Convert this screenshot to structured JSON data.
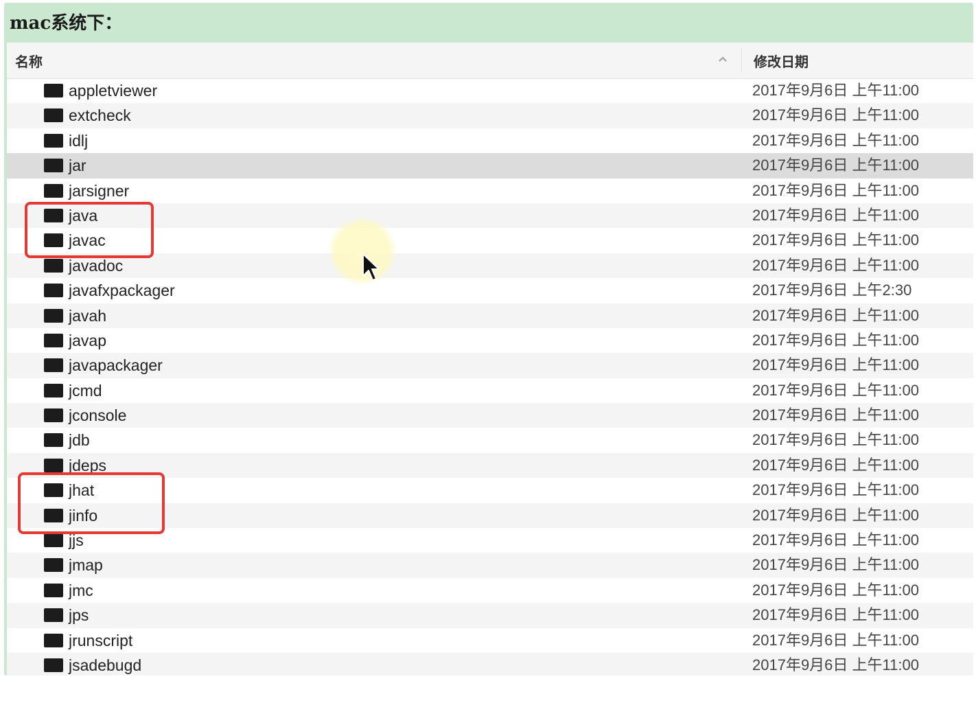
{
  "caption": "mac系统下：",
  "header": {
    "name_label": "名称",
    "date_label": "修改日期",
    "sort_icon": "chevron-up-icon"
  },
  "files": [
    {
      "name": "appletviewer",
      "date": "2017年9月6日 上午11:00"
    },
    {
      "name": "extcheck",
      "date": "2017年9月6日 上午11:00"
    },
    {
      "name": "idlj",
      "date": "2017年9月6日 上午11:00"
    },
    {
      "name": "jar",
      "date": "2017年9月6日 上午11:00"
    },
    {
      "name": "jarsigner",
      "date": "2017年9月6日 上午11:00"
    },
    {
      "name": "java",
      "date": "2017年9月6日 上午11:00"
    },
    {
      "name": "javac",
      "date": "2017年9月6日 上午11:00"
    },
    {
      "name": "javadoc",
      "date": "2017年9月6日 上午11:00"
    },
    {
      "name": "javafxpackager",
      "date": "2017年9月6日 上午2:30"
    },
    {
      "name": "javah",
      "date": "2017年9月6日 上午11:00"
    },
    {
      "name": "javap",
      "date": "2017年9月6日 上午11:00"
    },
    {
      "name": "javapackager",
      "date": "2017年9月6日 上午11:00"
    },
    {
      "name": "jcmd",
      "date": "2017年9月6日 上午11:00"
    },
    {
      "name": "jconsole",
      "date": "2017年9月6日 上午11:00"
    },
    {
      "name": "jdb",
      "date": "2017年9月6日 上午11:00"
    },
    {
      "name": "jdeps",
      "date": "2017年9月6日 上午11:00"
    },
    {
      "name": "jhat",
      "date": "2017年9月6日 上午11:00"
    },
    {
      "name": "jinfo",
      "date": "2017年9月6日 上午11:00"
    },
    {
      "name": "jjs",
      "date": "2017年9月6日 上午11:00"
    },
    {
      "name": "jmap",
      "date": "2017年9月6日 上午11:00"
    },
    {
      "name": "jmc",
      "date": "2017年9月6日 上午11:00"
    },
    {
      "name": "jps",
      "date": "2017年9月6日 上午11:00"
    },
    {
      "name": "jrunscript",
      "date": "2017年9月6日 上午11:00"
    },
    {
      "name": "jsadebugd",
      "date": "2017年9月6日 上午11:00"
    }
  ],
  "selected_file": "jar",
  "highlighted_files": [
    "java",
    "javac",
    "jhat",
    "jinfo"
  ],
  "colors": {
    "caption_bg": "#c9e8cf",
    "highlight_border": "#e53935",
    "selected_row": "#dcdcdc",
    "alt_row": "#f4f4f4"
  },
  "icons": {
    "file_icon": "executable-file-icon",
    "cursor": "mouse-pointer-icon"
  }
}
